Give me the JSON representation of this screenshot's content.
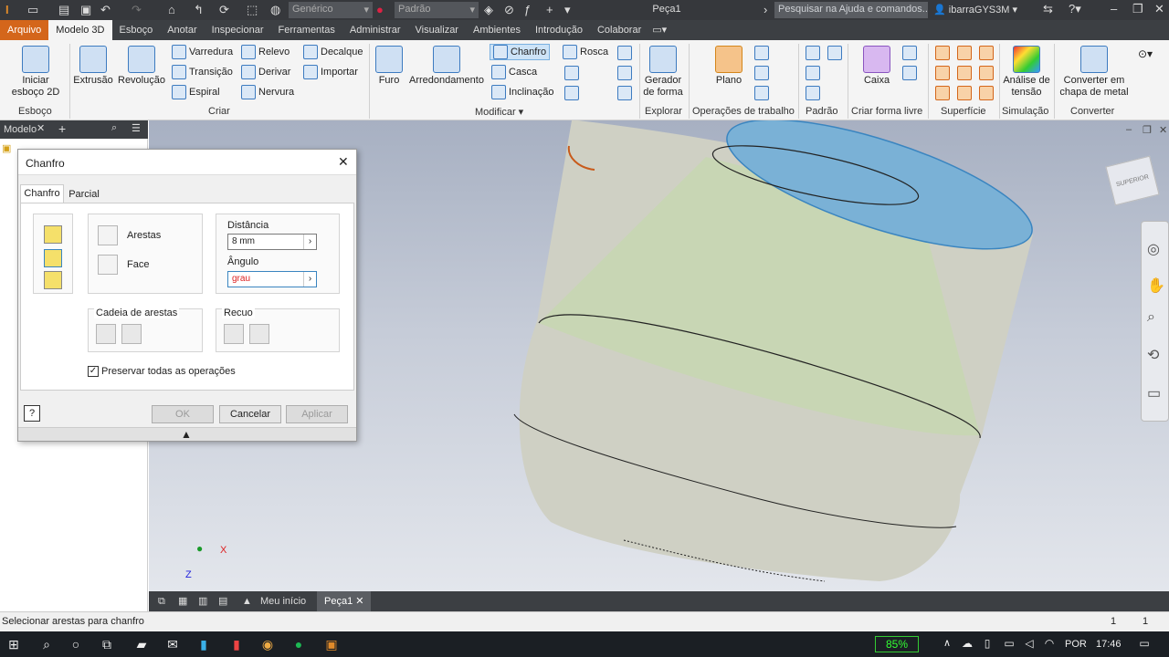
{
  "titlebar": {
    "style_combo": "Genérico",
    "appearance_combo": "Padrão",
    "doc_title": "Peça1",
    "search_placeholder": "Pesquisar na Ajuda e comandos...",
    "user": "ibarraGYS3M"
  },
  "menu": {
    "tabs": [
      "Arquivo",
      "Modelo 3D",
      "Esboço",
      "Anotar",
      "Inspecionar",
      "Ferramentas",
      "Administrar",
      "Visualizar",
      "Ambientes",
      "Introdução",
      "Colaborar"
    ]
  },
  "ribbon": {
    "iniciar_esboco": "Iniciar esboço 2D",
    "extrusao": "Extrusão",
    "revolucao": "Revolução",
    "varredura": "Varredura",
    "transicao": "Transição",
    "espiral": "Espiral",
    "relevo": "Relevo",
    "derivar": "Derivar",
    "nervura": "Nervura",
    "decalque": "Decalque",
    "importar": "Importar",
    "furo": "Furo",
    "arredondamento": "Arredondamento",
    "chanfro": "Chanfro",
    "casca": "Casca",
    "inclinacao": "Inclinação",
    "rosca": "Rosca",
    "gerador": "Gerador de forma",
    "plano": "Plano",
    "caixa": "Caixa",
    "analise": "Análise de tensão",
    "converter": "Converter em chapa de metal",
    "groups": {
      "esboco": "Esboço",
      "criar": "Criar",
      "modificar": "Modificar",
      "explorar": "Explorar",
      "operacoes": "Operações de trabalho",
      "padrao": "Padrão",
      "forma_livre": "Criar forma livre",
      "superficie": "Superfície",
      "simulacao": "Simulação",
      "converter": "Converter"
    }
  },
  "browser": {
    "title": "Modelo"
  },
  "dialog": {
    "title": "Chanfro",
    "tabs": [
      "Chanfro",
      "Parcial"
    ],
    "arestas": "Arestas",
    "face": "Face",
    "distancia_label": "Distância",
    "distancia_value": "8 mm",
    "angulo_label": "Ângulo",
    "angulo_value": "grau",
    "cadeia_label": "Cadeia de arestas",
    "recuo_label": "Recuo",
    "preservar": "Preservar todas as operações",
    "ok": "OK",
    "cancelar": "Cancelar",
    "aplicar": "Aplicar"
  },
  "viewcube": {
    "label": "SUPERIOR"
  },
  "triad": {
    "x": "X",
    "z": "Z"
  },
  "doctabs": {
    "home": "Meu início",
    "part": "Peça1"
  },
  "status": {
    "message": "Selecionar arestas para chanfro",
    "count1": "1",
    "count2": "1"
  },
  "taskbar": {
    "battery": "85%",
    "lang": "POR",
    "time": "17:46"
  }
}
